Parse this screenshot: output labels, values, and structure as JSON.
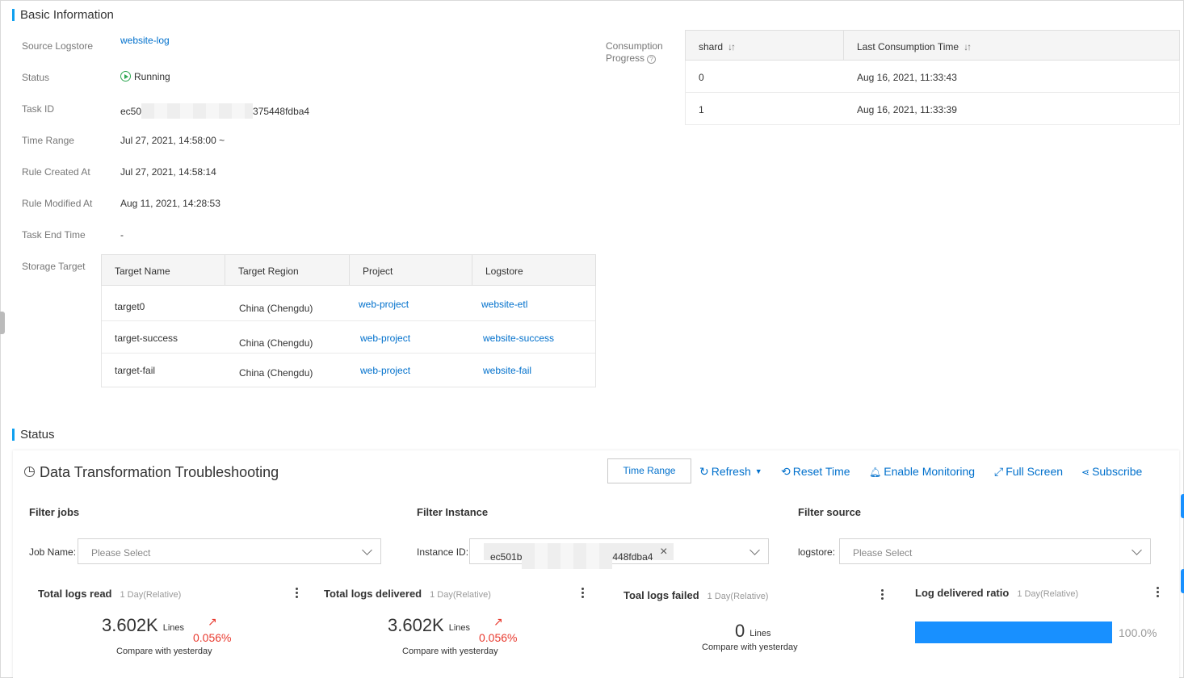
{
  "basic": {
    "heading": "Basic Information",
    "source_logstore_label": "Source Logstore",
    "source_logstore": "website-log",
    "status_label": "Status",
    "status": "Running",
    "task_id_label": "Task ID",
    "task_id_prefix": "ec50",
    "task_id_suffix": "375448fdba4",
    "time_range_label": "Time Range",
    "time_range": "Jul 27, 2021, 14:58:00 ~",
    "rule_created_label": "Rule Created At",
    "rule_created": "Jul 27, 2021, 14:58:14",
    "rule_modified_label": "Rule Modified At",
    "rule_modified": "Aug 11, 2021, 14:28:53",
    "task_end_label": "Task End Time",
    "task_end": "-",
    "storage_target_label": "Storage Target",
    "consumption_label_1": "Consumption",
    "consumption_label_2": "Progress"
  },
  "storage_table": {
    "headers": [
      "Target Name",
      "Target Region",
      "Project",
      "Logstore"
    ],
    "rows": [
      {
        "name": "target0",
        "region": "China (Chengdu)",
        "project": "web-project",
        "logstore": "website-etl"
      },
      {
        "name": "target-success",
        "region": "China (Chengdu)",
        "project": "web-project",
        "logstore": "website-success"
      },
      {
        "name": "target-fail",
        "region": "China (Chengdu)",
        "project": "web-project",
        "logstore": "website-fail"
      }
    ]
  },
  "consumption_table": {
    "headers": [
      "shard",
      "Last Consumption Time"
    ],
    "rows": [
      {
        "shard": "0",
        "time": "Aug 16, 2021, 11:33:43"
      },
      {
        "shard": "1",
        "time": "Aug 16, 2021, 11:33:39"
      }
    ]
  },
  "status_section": {
    "heading": "Status",
    "dashboard_title": "Data Transformation Troubleshooting",
    "time_range_btn": "Time Range",
    "refresh": "Refresh",
    "reset_time": "Reset Time",
    "enable_monitoring": "Enable Monitoring",
    "full_screen": "Full Screen",
    "subscribe": "Subscribe"
  },
  "filters": {
    "jobs_heading": "Filter jobs",
    "job_name_label": "Job Name:",
    "job_name_placeholder": "Please Select",
    "instance_heading": "Filter Instance",
    "instance_id_label": "Instance ID:",
    "instance_tag_prefix": "ec501b",
    "instance_tag_suffix": "448fdba4",
    "source_heading": "Filter source",
    "logstore_label": "logstore:",
    "logstore_placeholder": "Please Select"
  },
  "metrics": [
    {
      "title": "Total logs read",
      "range": "1 Day(Relative)",
      "value": "3.602K",
      "unit": "Lines",
      "change": "0.056%",
      "compare": "Compare with yesterday"
    },
    {
      "title": "Total logs delivered",
      "range": "1 Day(Relative)",
      "value": "3.602K",
      "unit": "Lines",
      "change": "0.056%",
      "compare": "Compare with yesterday"
    },
    {
      "title": "Toal logs failed",
      "range": "1 Day(Relative)",
      "value": "0",
      "unit": "Lines",
      "compare": "Compare with yesterday"
    },
    {
      "title": "Log delivered ratio",
      "range": "1 Day(Relative)",
      "ratio": "100.0%",
      "ratio_fraction": 1.0
    }
  ],
  "colors": {
    "accent": "#0fa0ef",
    "link": "#0070cc",
    "running": "#31a854",
    "trend_up": "#e8392e",
    "ratio_bar": "#1890ff"
  }
}
